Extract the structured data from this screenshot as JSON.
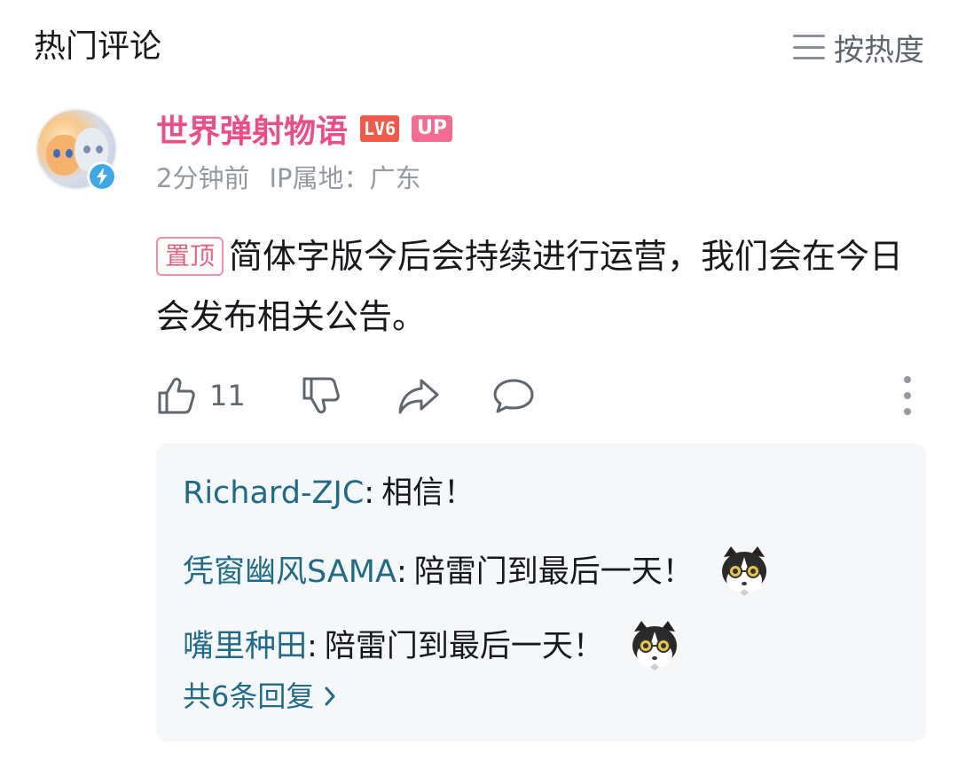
{
  "header": {
    "title": "热门评论",
    "sort_label": "按热度",
    "sort_icon": "list-sort-icon"
  },
  "comment": {
    "username": "世界弹射物语",
    "level_badge": "LV6",
    "up_badge": "UP",
    "time": "2分钟前",
    "ip_location": "IP属地：广东",
    "pin_tag": "置顶",
    "text": "简体字版今后会持续进行运营，我们会在今日会发布相关公告。",
    "like_count": "11",
    "colors": {
      "username": "#eb4e86",
      "level_badge": "#f05a4a",
      "up_badge": "#f36a95",
      "reply_name": "#1f6b8a"
    }
  },
  "replies": {
    "items": [
      {
        "name": "Richard-ZJC",
        "text": "相信！",
        "sticker": ""
      },
      {
        "name": "凭窗幽风SAMA",
        "text": "陪雷门到最后一天！",
        "sticker": "cat-sunglasses-sticker"
      },
      {
        "name": "嘴里种田",
        "text": "陪雷门到最后一天！",
        "sticker": "cat-sunglasses-sticker"
      }
    ],
    "view_all": "共6条回复"
  }
}
